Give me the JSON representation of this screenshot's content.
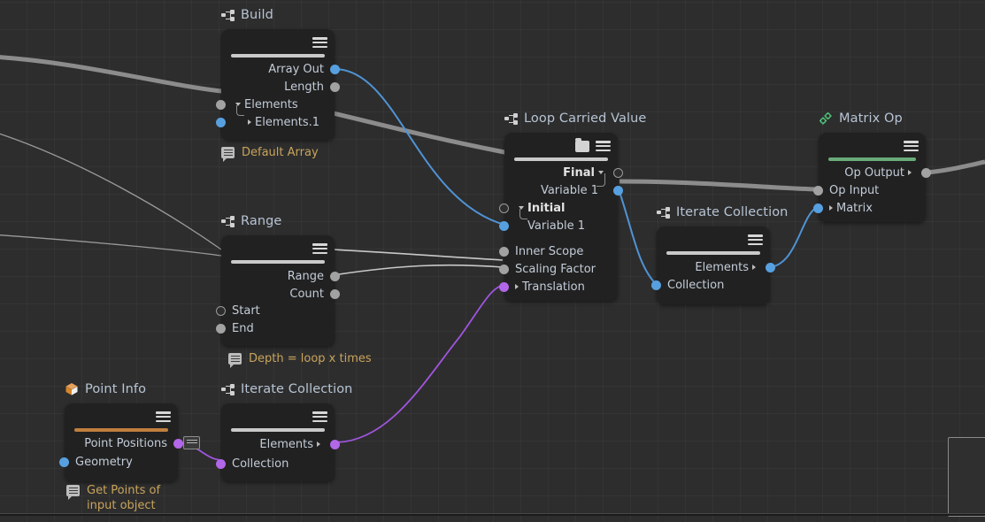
{
  "app": {
    "view": "node-graph-editor"
  },
  "nodes": [
    {
      "id": "build",
      "title": "Build",
      "icon": "node-graph-icon",
      "accent_color": "#c9c9c9",
      "header_icons": [
        "hamburger-icon"
      ],
      "outputs": [
        {
          "label": "Array Out",
          "socket": "blue"
        },
        {
          "label": "Length",
          "socket": "grey"
        }
      ],
      "inputs": [
        {
          "label": "Elements",
          "socket": "grey",
          "expander": "down"
        },
        {
          "label": "Elements.1",
          "socket": "blue",
          "expander": "right",
          "indent": true
        }
      ],
      "note": "Default Array"
    },
    {
      "id": "range",
      "title": "Range",
      "icon": "node-graph-icon",
      "accent_color": "#c9c9c9",
      "header_icons": [
        "hamburger-icon"
      ],
      "outputs": [
        {
          "label": "Range",
          "socket": "grey"
        },
        {
          "label": "Count",
          "socket": "grey"
        }
      ],
      "inputs": [
        {
          "label": "Start",
          "socket": "hollow"
        },
        {
          "label": "End",
          "socket": "grey"
        }
      ],
      "note": "Depth = loop x times"
    },
    {
      "id": "loop_carried_value",
      "title": "Loop Carried Value",
      "icon": "node-graph-icon",
      "accent_color": "#c9c9c9",
      "header_icons": [
        "folder-icon",
        "hamburger-icon"
      ],
      "outputs": [
        {
          "label": "Final",
          "socket": "hollow",
          "bold": true,
          "expander": "down"
        },
        {
          "label": "Variable 1",
          "socket": "blue",
          "expander": "elbow"
        }
      ],
      "inputs": [
        {
          "label": "Initial",
          "socket": "hollow",
          "bold": true,
          "expander": "down"
        },
        {
          "label": "Variable 1",
          "socket": "blue",
          "expander": "elbow",
          "indent": true
        },
        {
          "label": "Inner Scope",
          "socket": "grey"
        },
        {
          "label": "Scaling Factor",
          "socket": "grey"
        },
        {
          "label": "Translation",
          "socket": "purple",
          "expander": "right"
        }
      ],
      "note": ""
    },
    {
      "id": "iterate_collection_top",
      "title": "Iterate Collection",
      "icon": "node-graph-icon",
      "accent_color": "#c9c9c9",
      "header_icons": [
        "hamburger-icon"
      ],
      "outputs": [
        {
          "label": "Elements",
          "socket": "blue",
          "expander": "right"
        }
      ],
      "inputs": [
        {
          "label": "Collection",
          "socket": "blue"
        }
      ],
      "note": ""
    },
    {
      "id": "matrix_op",
      "title": "Matrix Op",
      "icon": "gears-icon",
      "accent_color": "#6aab7a",
      "header_icons": [
        "hamburger-icon"
      ],
      "outputs": [
        {
          "label": "Op Output",
          "socket": "grey",
          "expander": "right"
        }
      ],
      "inputs": [
        {
          "label": "Op Input",
          "socket": "grey"
        },
        {
          "label": "Matrix",
          "socket": "blue",
          "expander": "right"
        }
      ],
      "note": ""
    },
    {
      "id": "point_info",
      "title": "Point Info",
      "icon": "cube-icon",
      "accent_color": "#c07f3e",
      "header_icons": [
        "hamburger-icon"
      ],
      "outputs": [
        {
          "label": "Point Positions",
          "socket": "purple"
        }
      ],
      "inputs": [
        {
          "label": "Geometry",
          "socket": "blue"
        }
      ],
      "note": "Get Points of input object"
    },
    {
      "id": "iterate_collection_bottom",
      "title": "Iterate Collection",
      "icon": "node-graph-icon",
      "accent_color": "#c9c9c9",
      "header_icons": [
        "hamburger-icon"
      ],
      "outputs": [
        {
          "label": "Elements",
          "socket": "purple",
          "expander": "right"
        }
      ],
      "inputs": [
        {
          "label": "Collection",
          "socket": "purple"
        }
      ],
      "note": ""
    }
  ],
  "wire_colors": {
    "blue": "#4f93d4",
    "purple": "#a055e0",
    "grey": "#8c8c8c",
    "thin_grey": "#9a9a9a"
  }
}
